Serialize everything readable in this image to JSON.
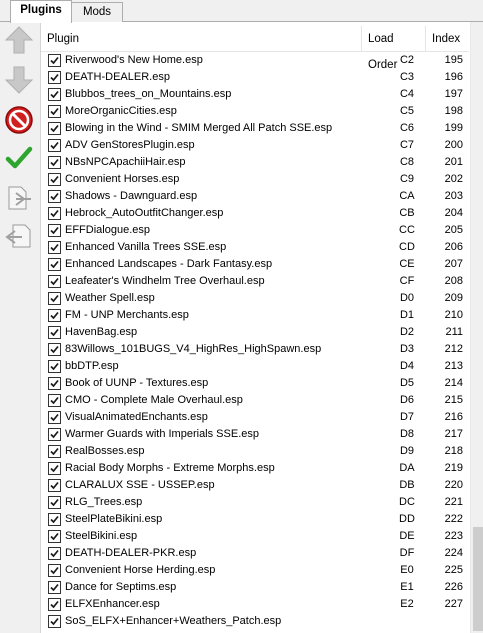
{
  "tabs": [
    {
      "label": "Plugins",
      "active": true
    },
    {
      "label": "Mods",
      "active": false
    }
  ],
  "toolbar": {
    "items": [
      {
        "icon": "arrow-up-icon",
        "enabled": false
      },
      {
        "icon": "arrow-down-icon",
        "enabled": false
      },
      {
        "icon": "no-entry-icon",
        "enabled": true
      },
      {
        "icon": "checkmark-icon",
        "enabled": true
      },
      {
        "icon": "export-icon",
        "enabled": false
      },
      {
        "icon": "import-icon",
        "enabled": false
      }
    ]
  },
  "columns": {
    "plugin": "Plugin",
    "load_order": "Load Order",
    "index": "Index"
  },
  "rows": [
    {
      "name": "Riverwood's New Home.esp",
      "order": "C2",
      "index": "195",
      "checked": true
    },
    {
      "name": "DEATH-DEALER.esp",
      "order": "C3",
      "index": "196",
      "checked": true
    },
    {
      "name": "Blubbos_trees_on_Mountains.esp",
      "order": "C4",
      "index": "197",
      "checked": true
    },
    {
      "name": "MoreOrganicCities.esp",
      "order": "C5",
      "index": "198",
      "checked": true
    },
    {
      "name": "Blowing in the Wind - SMIM Merged All Patch SSE.esp",
      "order": "C6",
      "index": "199",
      "checked": true
    },
    {
      "name": "ADV GenStoresPlugin.esp",
      "order": "C7",
      "index": "200",
      "checked": true
    },
    {
      "name": "NBsNPCApachiiHair.esp",
      "order": "C8",
      "index": "201",
      "checked": true
    },
    {
      "name": "Convenient Horses.esp",
      "order": "C9",
      "index": "202",
      "checked": true
    },
    {
      "name": "Shadows - Dawnguard.esp",
      "order": "CA",
      "index": "203",
      "checked": true
    },
    {
      "name": "Hebrock_AutoOutfitChanger.esp",
      "order": "CB",
      "index": "204",
      "checked": true
    },
    {
      "name": "EFFDialogue.esp",
      "order": "CC",
      "index": "205",
      "checked": true
    },
    {
      "name": "Enhanced Vanilla Trees SSE.esp",
      "order": "CD",
      "index": "206",
      "checked": true
    },
    {
      "name": "Enhanced Landscapes - Dark Fantasy.esp",
      "order": "CE",
      "index": "207",
      "checked": true
    },
    {
      "name": "Leafeater's Windhelm Tree Overhaul.esp",
      "order": "CF",
      "index": "208",
      "checked": true
    },
    {
      "name": "Weather Spell.esp",
      "order": "D0",
      "index": "209",
      "checked": true
    },
    {
      "name": "FM - UNP Merchants.esp",
      "order": "D1",
      "index": "210",
      "checked": true
    },
    {
      "name": "HavenBag.esp",
      "order": "D2",
      "index": "211",
      "checked": true
    },
    {
      "name": "83Willows_101BUGS_V4_HighRes_HighSpawn.esp",
      "order": "D3",
      "index": "212",
      "checked": true
    },
    {
      "name": "bbDTP.esp",
      "order": "D4",
      "index": "213",
      "checked": true
    },
    {
      "name": "Book of UUNP - Textures.esp",
      "order": "D5",
      "index": "214",
      "checked": true
    },
    {
      "name": "CMO - Complete Male Overhaul.esp",
      "order": "D6",
      "index": "215",
      "checked": true
    },
    {
      "name": "VisualAnimatedEnchants.esp",
      "order": "D7",
      "index": "216",
      "checked": true
    },
    {
      "name": "Warmer Guards with Imperials SSE.esp",
      "order": "D8",
      "index": "217",
      "checked": true
    },
    {
      "name": "RealBosses.esp",
      "order": "D9",
      "index": "218",
      "checked": true
    },
    {
      "name": "Racial Body Morphs - Extreme Morphs.esp",
      "order": "DA",
      "index": "219",
      "checked": true
    },
    {
      "name": "CLARALUX SSE - USSEP.esp",
      "order": "DB",
      "index": "220",
      "checked": true
    },
    {
      "name": "RLG_Trees.esp",
      "order": "DC",
      "index": "221",
      "checked": true
    },
    {
      "name": "SteelPlateBikini.esp",
      "order": "DD",
      "index": "222",
      "checked": true
    },
    {
      "name": "SteelBikini.esp",
      "order": "DE",
      "index": "223",
      "checked": true
    },
    {
      "name": "DEATH-DEALER-PKR.esp",
      "order": "DF",
      "index": "224",
      "checked": true
    },
    {
      "name": "Convenient Horse Herding.esp",
      "order": "E0",
      "index": "225",
      "checked": true
    },
    {
      "name": "Dance for Septims.esp",
      "order": "E1",
      "index": "226",
      "checked": true
    },
    {
      "name": "ELFXEnhancer.esp",
      "order": "E2",
      "index": "227",
      "checked": true
    },
    {
      "name": "SoS_ELFX+Enhancer+Weathers_Patch.esp",
      "order": "",
      "index": "",
      "checked": true
    }
  ]
}
